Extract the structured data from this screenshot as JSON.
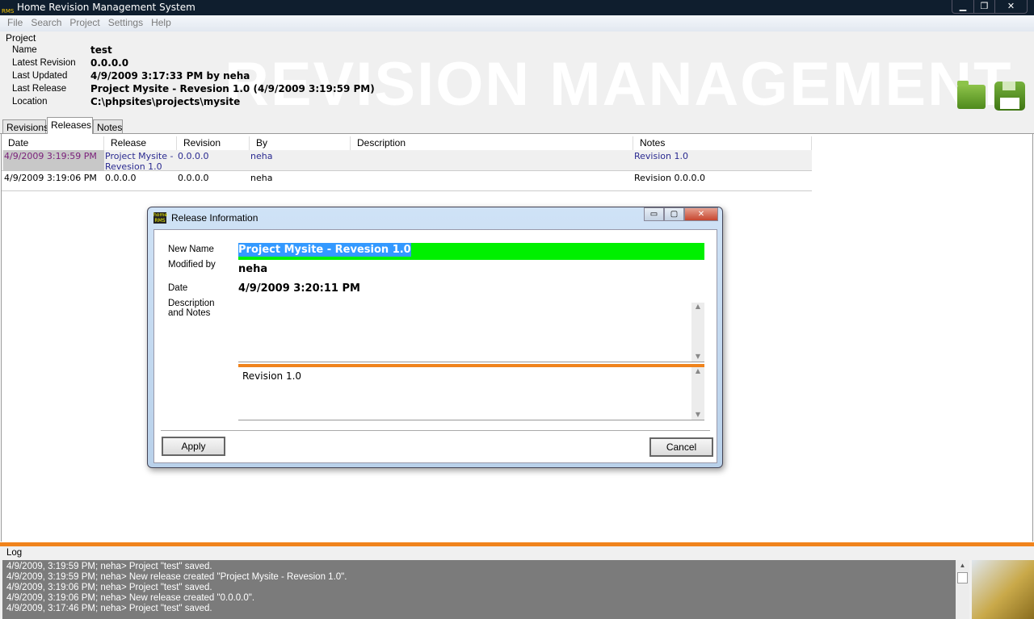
{
  "window": {
    "title": "Home Revision Management System",
    "logo_text": "RMS",
    "controls": [
      "minimize",
      "restore",
      "close"
    ]
  },
  "menu": [
    "File",
    "Search",
    "Project",
    "Settings",
    "Help"
  ],
  "project": {
    "group_label": "Project",
    "watermark": "REVISION MANAGEMENT",
    "fields": [
      {
        "label": "Name",
        "value": "test"
      },
      {
        "label": "Latest Revision",
        "value": "0.0.0.0"
      },
      {
        "label": "Last Updated",
        "value": "4/9/2009 3:17:33 PM by neha"
      },
      {
        "label": "Last Release",
        "value": "Project Mysite - Revesion 1.0 (4/9/2009 3:19:59 PM)"
      },
      {
        "label": "Location",
        "value": "C:\\phpsites\\projects\\mysite"
      }
    ],
    "icons": [
      "open-folder-icon",
      "save-icon"
    ]
  },
  "tabs": [
    {
      "label": "Revisions"
    },
    {
      "label": "Releases",
      "active": true
    },
    {
      "label": "Notes"
    }
  ],
  "releases": {
    "columns": [
      "Date",
      "Release",
      "Revision",
      "By",
      "Description",
      "Notes"
    ],
    "rows": [
      {
        "date": "4/9/2009 3:19:59 PM",
        "release": "Project Mysite - Revesion 1.0",
        "revision": "0.0.0.0",
        "by": "neha",
        "description": "",
        "notes": "Revision 1.0",
        "selected": true
      },
      {
        "date": "4/9/2009 3:19:06 PM",
        "release": "0.0.0.0",
        "revision": "0.0.0.0",
        "by": "neha",
        "description": "",
        "notes": "Revision 0.0.0.0"
      }
    ]
  },
  "log": {
    "label": "Log",
    "entries": [
      "4/9/2009, 3:19:59 PM; neha> Project \"test\" saved.",
      "4/9/2009, 3:19:59 PM; neha> New release created \"Project Mysite - Revesion 1.0\".",
      "4/9/2009, 3:19:06 PM; neha> Project \"test\" saved.",
      "4/9/2009, 3:19:06 PM; neha> New release created \"0.0.0.0\".",
      "4/9/2009, 3:17:46 PM; neha> Project \"test\" saved."
    ]
  },
  "dialog": {
    "title": "Release Information",
    "logo_text": "home RMS",
    "new_name_label": "New Name",
    "new_name_value": "Project Mysite - Revesion 1.0",
    "modified_by_label": "Modified by",
    "modified_by_value": "neha",
    "date_label": "Date",
    "date_value": "4/9/2009 3:20:11 PM",
    "desc_label_1": "Description",
    "desc_label_2": "and Notes",
    "description_value": "",
    "notes_value": "Revision 1.0",
    "apply_label": "Apply",
    "cancel_label": "Cancel"
  },
  "colors": {
    "accent_orange": "#f0831c",
    "name_field_bg": "#00f000",
    "selection": "#3399ff",
    "titlebar": "#0f1e2e"
  }
}
